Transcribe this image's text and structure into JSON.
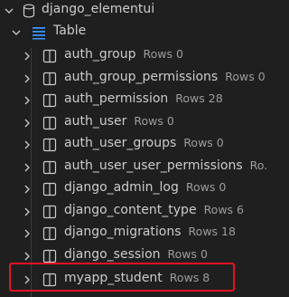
{
  "connection": {
    "name": "django_elementui",
    "icon": "database-icon"
  },
  "group": {
    "name": "Table",
    "icon": "list-icon"
  },
  "tables": [
    {
      "name": "auth_group",
      "rows": "Rows 0"
    },
    {
      "name": "auth_group_permissions",
      "rows": "Rows 0"
    },
    {
      "name": "auth_permission",
      "rows": "Rows 28"
    },
    {
      "name": "auth_user",
      "rows": "Rows 0"
    },
    {
      "name": "auth_user_groups",
      "rows": "Rows 0"
    },
    {
      "name": "auth_user_user_permissions",
      "rows": "Ro..."
    },
    {
      "name": "django_admin_log",
      "rows": "Rows 0"
    },
    {
      "name": "django_content_type",
      "rows": "Rows 6"
    },
    {
      "name": "django_migrations",
      "rows": "Rows 18"
    },
    {
      "name": "django_session",
      "rows": "Rows 0"
    },
    {
      "name": "myapp_student",
      "rows": "Rows 8"
    }
  ],
  "colors": {
    "background": "#1f1f1f",
    "text": "#cccccc",
    "description": "#9d9d9d",
    "highlight_border": "#e81123"
  }
}
